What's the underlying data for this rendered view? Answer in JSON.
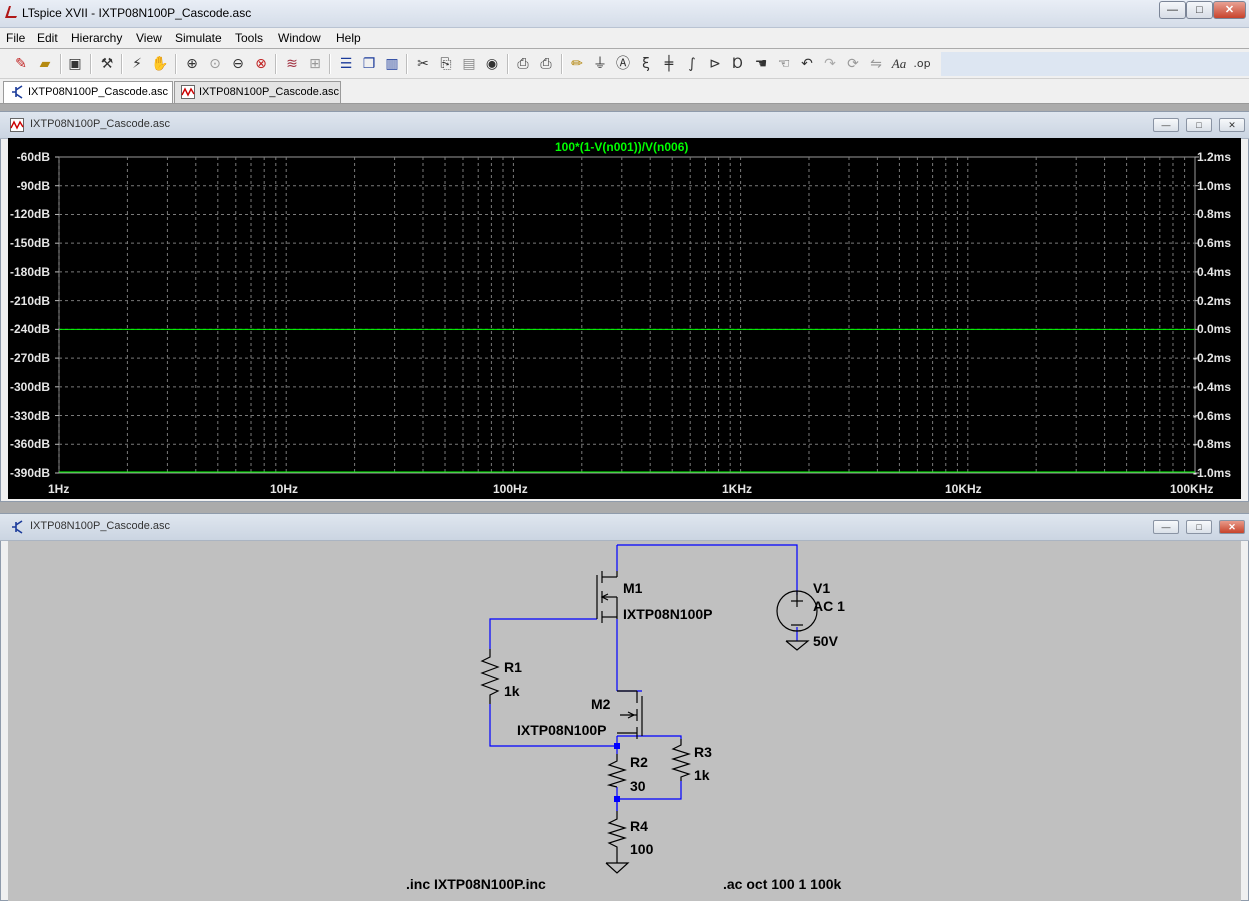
{
  "app": {
    "title": "LTspice XVII - IXTP08N100P_Cascode.asc",
    "window_buttons": {
      "minimize": "—",
      "maximize": "□",
      "close": "✕"
    }
  },
  "menu": [
    "File",
    "Edit",
    "Hierarchy",
    "View",
    "Simulate",
    "Tools",
    "Window",
    "Help"
  ],
  "toolbar": {
    "icons": [
      "new-schematic-icon",
      "open-icon",
      "save-icon",
      "control-panel-icon",
      "run-icon",
      "halt-icon",
      "zoom-in-icon",
      "pan-icon",
      "zoom-out-icon",
      "zoom-cancel-icon",
      "autorange-icon",
      "grid-icon",
      "tile-horizontal-icon",
      "cascade-icon",
      "tile-vertical-icon",
      "cut-icon",
      "copy-icon",
      "paste-icon",
      "find-icon",
      "print-setup-icon",
      "print-icon",
      "draw-wire-icon",
      "ground-icon",
      "label-net-icon",
      "resistor-icon",
      "capacitor-icon",
      "inductor-icon",
      "diode-icon",
      "component-icon",
      "move-icon",
      "drag-icon",
      "undo-icon",
      "redo-icon",
      "rotate-icon",
      "mirror-icon",
      "text-icon",
      "spice-directive-icon"
    ],
    "text_labels": {
      "text": "Aa",
      "op": ".op"
    }
  },
  "tabs": [
    {
      "label": "IXTP08N100P_Cascode.asc",
      "icon": "schematic-icon",
      "active": true
    },
    {
      "label": "IXTP08N100P_Cascode.asc",
      "icon": "waveform-icon",
      "active": false
    }
  ],
  "plot_window": {
    "title": "IXTP08N100P_Cascode.asc",
    "trace_expression": "100*(1-V(n001))/V(n006)",
    "trace_color": "#00ff00",
    "left_axis": [
      "-60dB",
      "-90dB",
      "-120dB",
      "-150dB",
      "-180dB",
      "-210dB",
      "-240dB",
      "-270dB",
      "-300dB",
      "-330dB",
      "-360dB",
      "-390dB"
    ],
    "right_axis": [
      "1.2ms",
      "1.0ms",
      "0.8ms",
      "0.6ms",
      "0.4ms",
      "0.2ms",
      "0.0ms",
      "-0.2ms",
      "-0.4ms",
      "-0.6ms",
      "-0.8ms",
      "-1.0ms"
    ],
    "x_axis": [
      "1Hz",
      "10Hz",
      "100Hz",
      "1KHz",
      "10KHz",
      "100KHz"
    ]
  },
  "schematic_window": {
    "title": "IXTP08N100P_Cascode.asc",
    "components": {
      "M1": {
        "name": "M1",
        "model": "IXTP08N100P"
      },
      "M2": {
        "name": "M2",
        "model": "IXTP08N100P"
      },
      "V1": {
        "name": "V1",
        "ac": "AC 1",
        "dc": "50V"
      },
      "R1": {
        "name": "R1",
        "value": "1k"
      },
      "R2": {
        "name": "R2",
        "value": "30"
      },
      "R3": {
        "name": "R3",
        "value": "1k"
      },
      "R4": {
        "name": "R4",
        "value": "100"
      }
    },
    "directives": {
      "include": ".inc IXTP08N100P.inc",
      "analysis": ".ac oct 100 1 100k"
    },
    "wire_color": "#0000ff"
  }
}
